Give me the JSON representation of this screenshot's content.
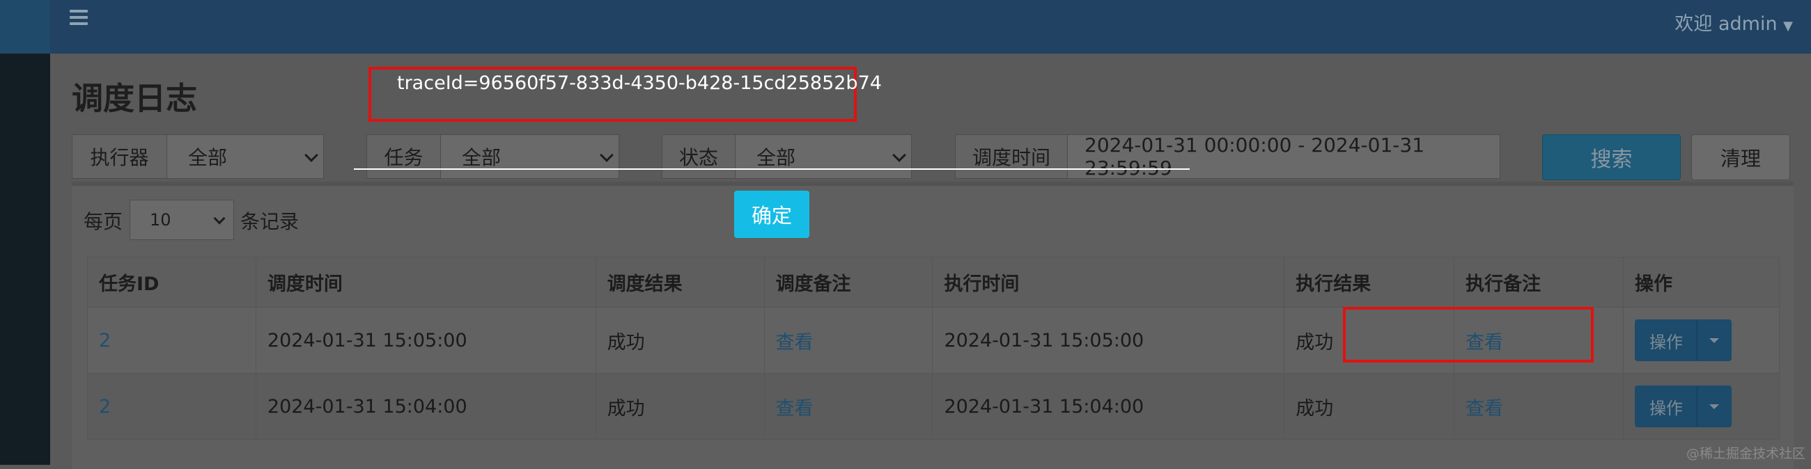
{
  "header": {
    "user_menu": "欢迎 admin"
  },
  "page": {
    "title": "调度日志"
  },
  "filters": {
    "executor": {
      "label": "执行器",
      "value": "全部"
    },
    "job": {
      "label": "任务",
      "value": "全部"
    },
    "status": {
      "label": "状态",
      "value": "全部"
    },
    "time": {
      "label": "调度时间",
      "value": "2024-01-31 00:00:00 - 2024-01-31 23:59:59"
    },
    "search_label": "搜索",
    "clear_label": "清理"
  },
  "pagination": {
    "prefix": "每页",
    "page_size": "10",
    "suffix": "条记录"
  },
  "table": {
    "headers": [
      "任务ID",
      "调度时间",
      "调度结果",
      "调度备注",
      "执行时间",
      "执行结果",
      "执行备注",
      "操作"
    ],
    "rows": [
      {
        "job_id": "2",
        "trigger_time": "2024-01-31 15:05:00",
        "trigger_result": "成功",
        "trigger_msg": "查看",
        "handle_time": "2024-01-31 15:05:00",
        "handle_result": "成功",
        "handle_msg": "查看",
        "op": "操作"
      },
      {
        "job_id": "2",
        "trigger_time": "2024-01-31 15:04:00",
        "trigger_result": "成功",
        "trigger_msg": "查看",
        "handle_time": "2024-01-31 15:04:00",
        "handle_result": "成功",
        "handle_msg": "查看",
        "op": "操作"
      }
    ]
  },
  "overlay": {
    "trace_id": "traceId=96560f57-833d-4350-b428-15cd25852b74",
    "confirm_label": "确定"
  },
  "watermark": "@稀土掘金技术社区",
  "colors": {
    "highlight": "#e01212",
    "confirm": "#15bde6",
    "success": "#1c4c14",
    "link": "#1f4f70"
  },
  "icons": {
    "menu_toggle": "hamburger-icon",
    "dropdown": "chevron-down-icon",
    "user_dropdown": "caret-down-icon"
  }
}
